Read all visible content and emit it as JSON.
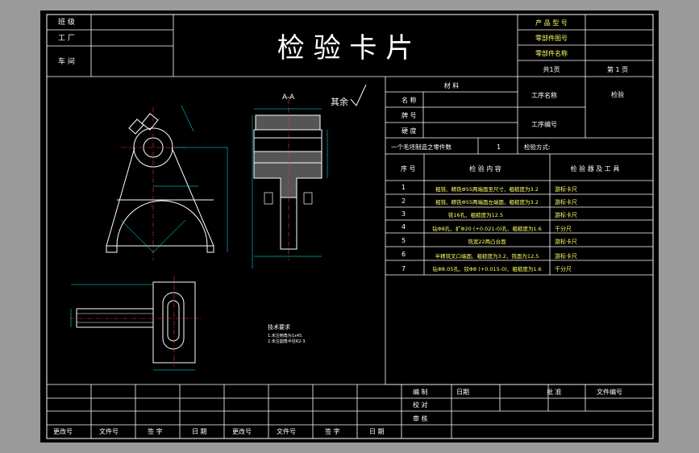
{
  "header": {
    "left_labels": [
      "班 级",
      "工 厂",
      "车 间"
    ],
    "title": "检 验 卡 片",
    "right_labels": [
      "产 品 型 号",
      "零部件图号",
      "零部件名称"
    ],
    "page_total": "共1页",
    "page_current": "第 1 页"
  },
  "info": {
    "material_header": "材 料",
    "material_rows": [
      "名 称",
      "牌 号",
      "硬 度"
    ],
    "process_name_label": "工序名称",
    "process_name_value": "检验",
    "process_no_label": "工序编号",
    "batch_label": "一个毛坯制造之零件数",
    "batch_value": "1",
    "check_form_label": "检验方式:"
  },
  "table": {
    "headers": [
      "序 号",
      "检 验 内 容",
      "检 验 器 及 工 具"
    ],
    "rows": [
      {
        "no": "1",
        "content": "粗铣、精铣Φ55两端面至尺寸、粗糙度为3.2",
        "tool": "游标卡尺"
      },
      {
        "no": "2",
        "content": "粗铣、精铣Φ55两端面左端面、粗糙度为3.2",
        "tool": "游标卡尺"
      },
      {
        "no": "3",
        "content": "铣16孔、粗糙度为12.5",
        "tool": "游标卡尺"
      },
      {
        "no": "4",
        "content": "钻Φ8孔、扩Φ20 (+0.021-0)孔、粗糙度为1.6",
        "tool": "千分尺"
      },
      {
        "no": "5",
        "content": "铣宽22两凸台面",
        "tool": "游标卡尺"
      },
      {
        "no": "6",
        "content": "半精铣叉口端面、粗糙度为3.2、铣面为12.5",
        "tool": "游标卡尺"
      },
      {
        "no": "7",
        "content": "钻Φ8.05孔、铰Φ8 (+0.015-0)、粗糙度为1.6",
        "tool": "千分尺"
      }
    ]
  },
  "drawing": {
    "section_label": "A-A",
    "roughness_note": "其余",
    "tech_req_title": "技术要求",
    "tech_req_items": [
      "1.未注倒角为1x45.",
      "2.未注圆角半径R2-3."
    ]
  },
  "footer": {
    "sign_labels": [
      "编 制",
      "校 对",
      "审 核"
    ],
    "sign_date": "日期",
    "approve_label": "批 准",
    "doc_no_label": "文件编号",
    "bottom_labels": [
      "更改号",
      "文件号",
      "签 字",
      "日 期",
      "更改号",
      "文件号",
      "签 字",
      "日 期"
    ]
  }
}
